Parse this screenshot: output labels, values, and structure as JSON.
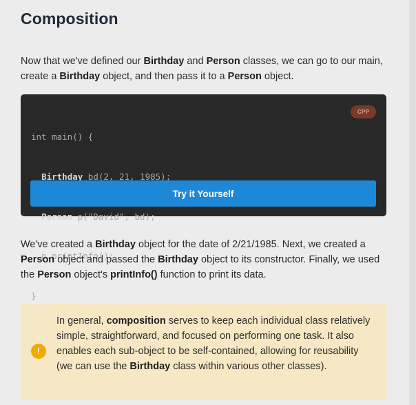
{
  "heading": "Composition",
  "intro": {
    "t1": "Now that we've defined our ",
    "b1": "Birthday",
    "t2": " and ",
    "b2": "Person",
    "t3": " classes, we can go to our main, create a ",
    "b3": "Birthday",
    "t4": " object, and then pass it to a ",
    "b4": "Person",
    "t5": " object."
  },
  "code_block": {
    "language_badge": "CPP",
    "lines": [
      {
        "a": "int main() {",
        "type": "",
        "b": ""
      },
      {
        "a": "  ",
        "type": "Birthday",
        "b": " bd(2, 21, 1985);"
      },
      {
        "a": "  ",
        "type": "Person",
        "b": " p(\"David\", bd);"
      },
      {
        "a": "  p.printInfo();",
        "type": "",
        "b": ""
      },
      {
        "a": "}",
        "type": "",
        "b": ""
      }
    ],
    "try_button_label": "Try it Yourself"
  },
  "explanation": {
    "t1": "We've created a ",
    "b1": "Birthday",
    "t2": " object for the date of 2/21/1985. Next, we created a ",
    "b2": "Person",
    "t3": " object and passed the ",
    "b3": "Birthday",
    "t4": " object to its constructor. Finally, we used the ",
    "b4": "Person",
    "t5": " object's ",
    "b5": "printInfo()",
    "t6": " function to print its data."
  },
  "note": {
    "icon": "!",
    "t1": "In general, ",
    "b1": "composition",
    "t2": " serves to keep each individual class relatively simple, straightforward, and focused on performing one task. It also enables each sub-object to be self-contained, allowing for reusability (we can use the ",
    "b2": "Birthday",
    "t3": " class within various other classes)."
  },
  "colors": {
    "background": "#ececec",
    "code_background": "#282828",
    "button_blue": "#1e88d8",
    "badge_background": "#7a3a2a",
    "note_background": "#f6e8c4",
    "warning_icon": "#f2a900"
  }
}
